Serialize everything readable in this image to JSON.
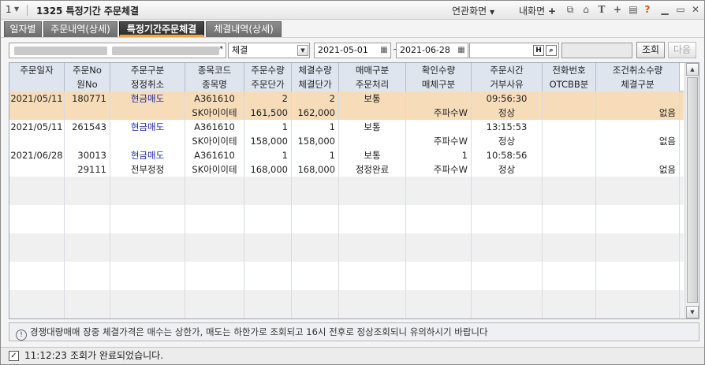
{
  "title": {
    "window_number": "1",
    "screen_title": "1325 특정기간 주문체결",
    "related_screen": "연관화면",
    "my_screen": "내화면",
    "help": "?"
  },
  "tabs": [
    {
      "label": "일자별"
    },
    {
      "label": "주문내역(상세)"
    },
    {
      "label": "특정기간주문체결"
    },
    {
      "label": "체결내역(상세)"
    }
  ],
  "filter": {
    "account_value": "",
    "status_select": "체결",
    "date_from": "2021-05-01",
    "date_sep": "~",
    "date_to": "2021-06-28",
    "stock_code": "",
    "stock_name": "",
    "search_button": "조회",
    "next_button": "다음",
    "code_btn": "H"
  },
  "grid": {
    "header_top": [
      "주문일자",
      "주문No",
      "주문구분",
      "종목코드",
      "주문수량",
      "체결수량",
      "매매구분",
      "확인수량",
      "주문시간",
      "전화번호",
      "조건취소수량"
    ],
    "header_bottom": [
      "",
      "원No",
      "정정취소",
      "종목명",
      "주문단가",
      "체결단가",
      "주문처리",
      "매체구분",
      "거부사유",
      "OTCBB분",
      "체결구분"
    ],
    "records": [
      {
        "top": [
          "2021/05/11",
          "180771",
          "현금매도",
          "A361610",
          "2",
          "2",
          "보통",
          "",
          "09:56:30",
          "",
          ""
        ],
        "bottom": [
          "",
          "",
          "",
          "SK아이이테",
          "161,500",
          "162,000",
          "",
          "주파수W",
          "정상",
          "",
          "없음"
        ]
      },
      {
        "top": [
          "2021/05/11",
          "261543",
          "현금매도",
          "A361610",
          "1",
          "1",
          "보통",
          "",
          "13:15:53",
          "",
          ""
        ],
        "bottom": [
          "",
          "",
          "",
          "SK아이이테",
          "158,000",
          "158,000",
          "",
          "주파수W",
          "정상",
          "",
          "없음"
        ]
      },
      {
        "top": [
          "2021/06/28",
          "30013",
          "현금매도",
          "A361610",
          "1",
          "1",
          "보통",
          "1",
          "10:58:56",
          "",
          ""
        ],
        "bottom": [
          "",
          "29111",
          "전부정정",
          "SK아이이테",
          "168,000",
          "168,000",
          "정정완료",
          "주파수W",
          "정상",
          "",
          "없음"
        ]
      }
    ]
  },
  "notice": "경쟁대량매매 장중 체결가격은 매수는 상한가, 매도는 하한가로 조회되고 16시 전후로 정상조회되니 유의하시기 바랍니다",
  "status": {
    "time": "11:12:23",
    "message": "조회가 완료되었습니다."
  },
  "colors": {
    "selected_row": "#f6dcb8",
    "header_bg": "#dfe5ef",
    "buy_sell_text": "#1e2aa5",
    "active_tab_underline": "#f2a24a"
  }
}
